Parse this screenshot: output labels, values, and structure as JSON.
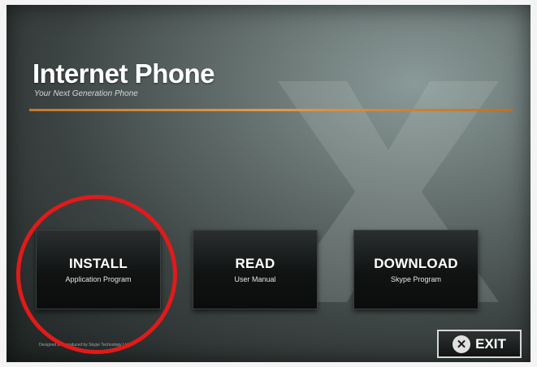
{
  "app": {
    "title": "Internet Phone",
    "subtitle": "Your Next Generation Phone"
  },
  "buttons": [
    {
      "label": "INSTALL",
      "sub": "Application Program"
    },
    {
      "label": "READ",
      "sub": "User Manual"
    },
    {
      "label": "DOWNLOAD",
      "sub": "Skype Program"
    }
  ],
  "exit": {
    "label": "EXIT",
    "icon": "x-circle-icon"
  },
  "footer": {
    "text": "Designed and produced by Skype Technology Ltd."
  },
  "colors": {
    "accent_line": "#e49a48",
    "highlight": "#e11a1a",
    "button_bg": "#111313"
  }
}
